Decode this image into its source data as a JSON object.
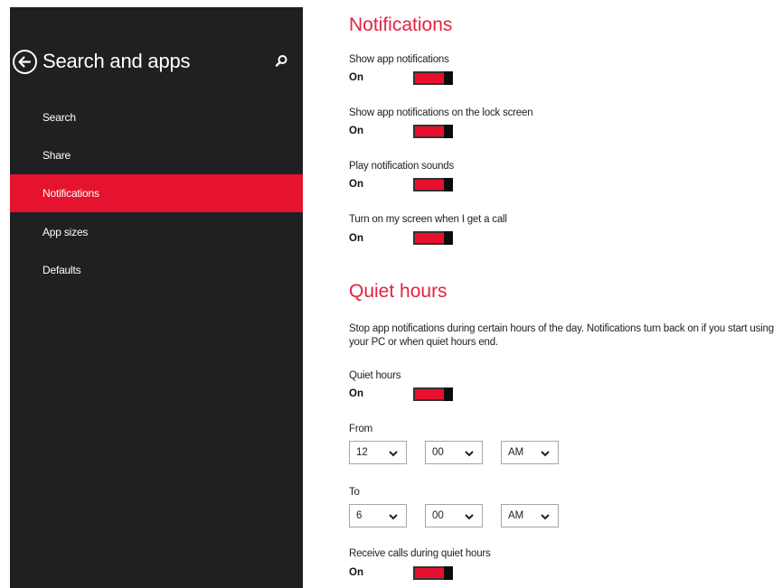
{
  "sidebar": {
    "title": "Search and apps",
    "items": [
      {
        "label": "Search"
      },
      {
        "label": "Share"
      },
      {
        "label": "Notifications",
        "active": true
      },
      {
        "label": "App sizes"
      },
      {
        "label": "Defaults"
      }
    ]
  },
  "notifications": {
    "title": "Notifications",
    "settings": [
      {
        "label": "Show app notifications",
        "state": "On",
        "on": true
      },
      {
        "label": "Show app notifications on the lock screen",
        "state": "On",
        "on": true
      },
      {
        "label": "Play notification sounds",
        "state": "On",
        "on": true
      },
      {
        "label": "Turn on my screen when I get a call",
        "state": "On",
        "on": true
      }
    ]
  },
  "quiet_hours": {
    "title": "Quiet hours",
    "description": "Stop app notifications during certain hours of the day. Notifications turn back on if you start using your PC or when quiet hours end.",
    "toggle": {
      "label": "Quiet hours",
      "state": "On",
      "on": true
    },
    "from": {
      "label": "From",
      "hour": "12",
      "minute": "00",
      "ampm": "AM"
    },
    "to": {
      "label": "To",
      "hour": "6",
      "minute": "00",
      "ampm": "AM"
    },
    "receive_calls": {
      "label": "Receive calls during quiet hours",
      "state": "On",
      "on": true
    }
  },
  "colors": {
    "accent": "#e5132d",
    "sidebar_bg": "#1e2022",
    "heading": "#e5223f"
  }
}
